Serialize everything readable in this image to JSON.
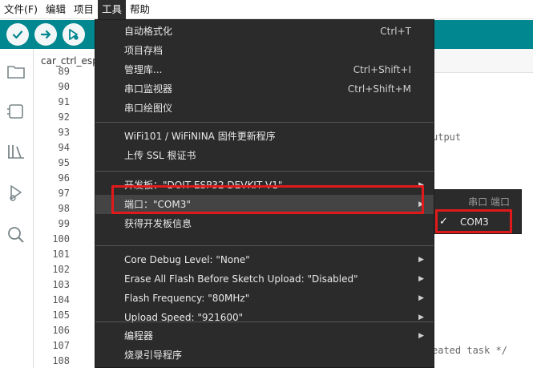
{
  "menubar": {
    "items": [
      "文件(F)",
      "编辑",
      "项目",
      "工具",
      "帮助"
    ]
  },
  "tabs": [
    {
      "label": "car_ctrl_esp"
    }
  ],
  "editor": {
    "line_numbers": [
      "89",
      "90",
      "91",
      "92",
      "93",
      "94",
      "95",
      "96",
      "97",
      "98",
      "99",
      "100",
      "101",
      "102",
      "103",
      "104",
      "105",
      "106",
      "107",
      "108"
    ],
    "code_fragments": {
      "output": "utput",
      "created_task": "eated task */"
    }
  },
  "tools_menu": {
    "groups": [
      [
        {
          "label": "自动格式化",
          "shortcut": "Ctrl+T"
        },
        {
          "label": "项目存档",
          "shortcut": ""
        },
        {
          "label": "管理库...",
          "shortcut": "Ctrl+Shift+I"
        },
        {
          "label": "串口监视器",
          "shortcut": "Ctrl+Shift+M"
        },
        {
          "label": "串口绘图仪",
          "shortcut": ""
        }
      ],
      [
        {
          "label": "WiFi101 / WiFiNINA 固件更新程序",
          "shortcut": ""
        },
        {
          "label": "上传 SSL 根证书",
          "shortcut": ""
        }
      ],
      [
        {
          "label": "开发板：\"DOIT ESP32 DEVKIT V1\"",
          "shortcut": ""
        },
        {
          "label": "端口：\"COM3\"",
          "shortcut": ""
        },
        {
          "label": "获得开发板信息",
          "shortcut": ""
        }
      ],
      [
        {
          "label": "Core Debug Level: \"None\"",
          "shortcut": ""
        },
        {
          "label": "Erase All Flash Before Sketch Upload: \"Disabled\"",
          "shortcut": ""
        },
        {
          "label": "Flash Frequency: \"80MHz\"",
          "shortcut": ""
        },
        {
          "label": "Upload Speed: \"921600\"",
          "shortcut": ""
        }
      ],
      [
        {
          "label": "编程器",
          "shortcut": ""
        },
        {
          "label": "烧录引导程序",
          "shortcut": ""
        }
      ]
    ]
  },
  "port_submenu": {
    "header": "串口 端口",
    "items": [
      {
        "label": "COM3",
        "checked": "✓"
      }
    ]
  }
}
